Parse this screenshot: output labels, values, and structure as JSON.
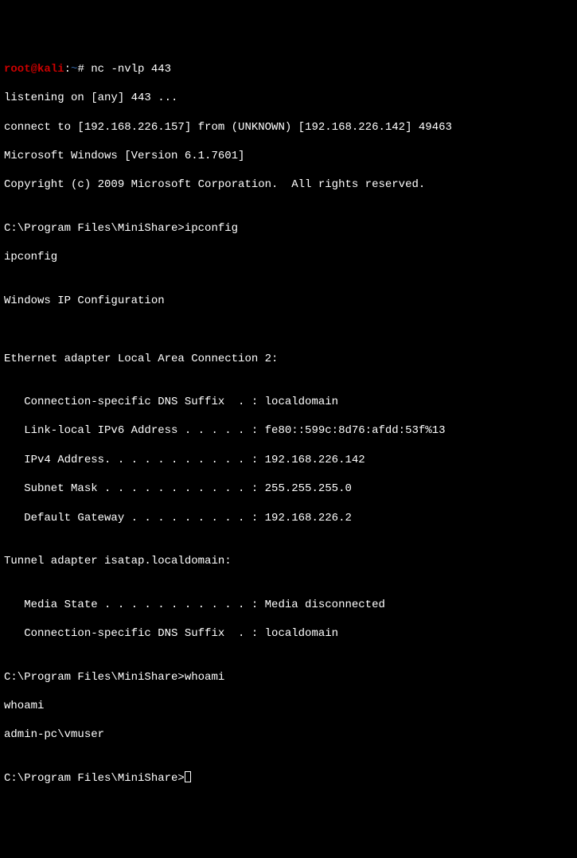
{
  "prompt1": {
    "user": "root",
    "at": "@",
    "host": "kali",
    "sep": ":",
    "path": "~",
    "hash": "# ",
    "command": "nc -nvlp 443"
  },
  "lines": {
    "listening": "listening on [any] 443 ...",
    "connect": "connect to [192.168.226.157] from (UNKNOWN) [192.168.226.142] 49463",
    "msver": "Microsoft Windows [Version 6.1.7601]",
    "copyright": "Copyright (c) 2009 Microsoft Corporation.  All rights reserved.",
    "blank1": "",
    "prompt2": "C:\\Program Files\\MiniShare>ipconfig",
    "echo_ipconfig": "ipconfig",
    "blank2": "",
    "winip": "Windows IP Configuration",
    "blank3": "",
    "blank4": "",
    "eth_header": "Ethernet adapter Local Area Connection 2:",
    "blank5": "",
    "dns_suffix": "   Connection-specific DNS Suffix  . : localdomain",
    "ipv6": "   Link-local IPv6 Address . . . . . : fe80::599c:8d76:afdd:53f%13",
    "ipv4": "   IPv4 Address. . . . . . . . . . . : 192.168.226.142",
    "subnet": "   Subnet Mask . . . . . . . . . . . : 255.255.255.0",
    "gateway": "   Default Gateway . . . . . . . . . : 192.168.226.2",
    "blank6": "",
    "tunnel_header": "Tunnel adapter isatap.localdomain:",
    "blank7": "",
    "media_state": "   Media State . . . . . . . . . . . : Media disconnected",
    "tunnel_dns": "   Connection-specific DNS Suffix  . : localdomain",
    "blank8": "",
    "prompt3": "C:\\Program Files\\MiniShare>whoami",
    "echo_whoami": "whoami",
    "whoami_result": "admin-pc\\vmuser",
    "blank9": "",
    "prompt4": "C:\\Program Files\\MiniShare>"
  }
}
